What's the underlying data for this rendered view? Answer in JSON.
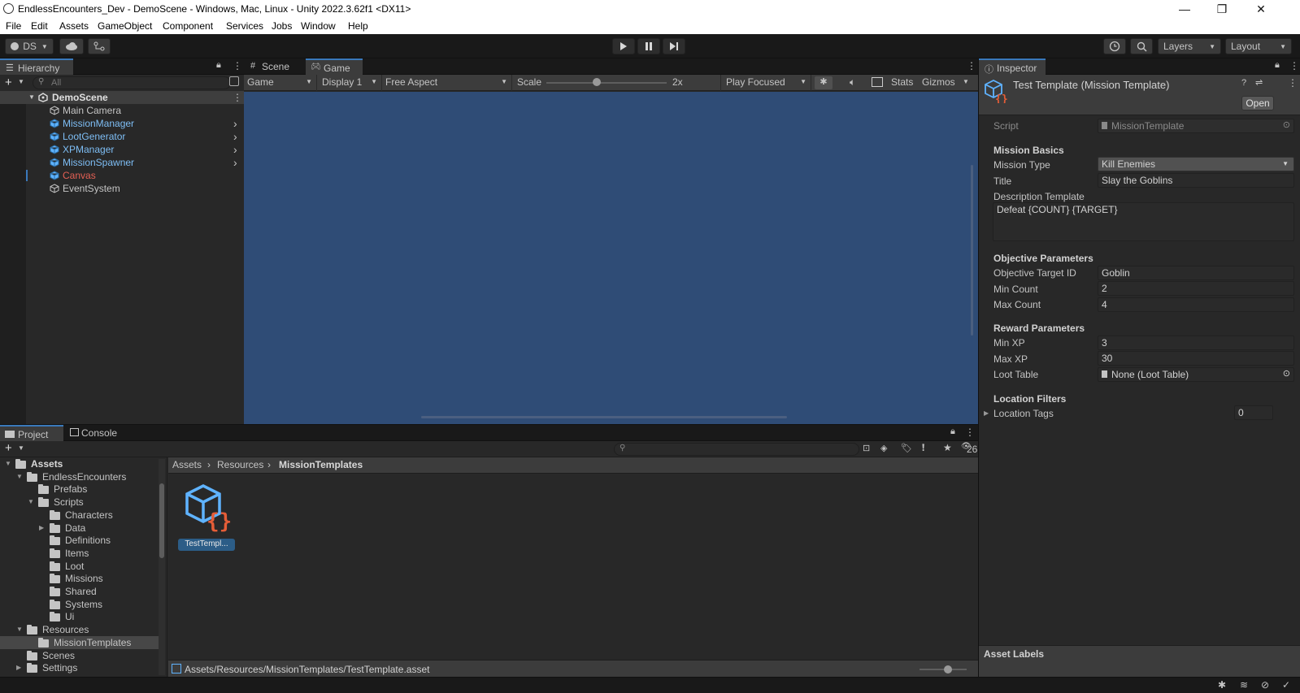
{
  "window": {
    "title": "EndlessEncounters_Dev - DemoScene - Windows, Mac, Linux - Unity 2022.3.62f1 <DX11>",
    "minimize": "—",
    "maximize": "❐",
    "close": "✕"
  },
  "menu": [
    "File",
    "Edit",
    "Assets",
    "GameObject",
    "Component",
    "Services",
    "Jobs",
    "Window",
    "Help"
  ],
  "toolbar": {
    "account_label": "DS",
    "layers_label": "Layers",
    "layout_label": "Layout"
  },
  "hierarchy": {
    "tab_label": "Hierarchy",
    "search_placeholder": "All",
    "scene_name": "DemoScene",
    "items": [
      {
        "label": "Main Camera",
        "style": "normal"
      },
      {
        "label": "MissionManager",
        "style": "prefab"
      },
      {
        "label": "LootGenerator",
        "style": "prefab"
      },
      {
        "label": "XPManager",
        "style": "prefab"
      },
      {
        "label": "MissionSpawner",
        "style": "prefab"
      },
      {
        "label": "Canvas",
        "style": "missing"
      },
      {
        "label": "EventSystem",
        "style": "normal"
      }
    ]
  },
  "game_view": {
    "tabs": [
      "Scene",
      "Game"
    ],
    "active_tab": "Game",
    "mode": "Game",
    "display": "Display 1",
    "aspect": "Free Aspect",
    "scale_label": "Scale",
    "scale_value": "2x",
    "scale_fraction": 0.42,
    "play_mode": "Play Focused",
    "stats": "Stats",
    "gizmos": "Gizmos",
    "background_color": "#2f4c76"
  },
  "inspector": {
    "tab_label": "Inspector",
    "object_title": "Test Template (Mission Template)",
    "open_button": "Open",
    "script_label": "Script",
    "script_value": "MissionTemplate",
    "sections": {
      "basics": "Mission Basics",
      "objective": "Objective Parameters",
      "reward": "Reward Parameters",
      "location": "Location Filters"
    },
    "mission_type_label": "Mission Type",
    "mission_type_value": "Kill Enemies",
    "title_label": "Title",
    "title_value": "Slay the Goblins",
    "description_label": "Description Template",
    "description_value": "Defeat {COUNT} {TARGET}",
    "objective_target_label": "Objective Target ID",
    "objective_target_value": "Goblin",
    "min_count_label": "Min Count",
    "min_count_value": "2",
    "max_count_label": "Max Count",
    "max_count_value": "4",
    "min_xp_label": "Min XP",
    "min_xp_value": "3",
    "max_xp_label": "Max XP",
    "max_xp_value": "30",
    "loot_table_label": "Loot Table",
    "loot_table_value": "None (Loot Table)",
    "location_tags_label": "Location Tags",
    "location_tags_value": "0",
    "asset_labels": "Asset Labels"
  },
  "project": {
    "tabs": [
      "Project",
      "Console"
    ],
    "hidden_count": "26",
    "breadcrumb": [
      "Assets",
      "Resources",
      "MissionTemplates"
    ],
    "tree": [
      {
        "label": "Assets",
        "depth": 0,
        "arrow": "down",
        "bold": true
      },
      {
        "label": "EndlessEncounters",
        "depth": 1,
        "arrow": "down"
      },
      {
        "label": "Prefabs",
        "depth": 2,
        "arrow": ""
      },
      {
        "label": "Scripts",
        "depth": 2,
        "arrow": "down"
      },
      {
        "label": "Characters",
        "depth": 3,
        "arrow": ""
      },
      {
        "label": "Data",
        "depth": 3,
        "arrow": "right"
      },
      {
        "label": "Definitions",
        "depth": 3,
        "arrow": ""
      },
      {
        "label": "Items",
        "depth": 3,
        "arrow": ""
      },
      {
        "label": "Loot",
        "depth": 3,
        "arrow": ""
      },
      {
        "label": "Missions",
        "depth": 3,
        "arrow": ""
      },
      {
        "label": "Shared",
        "depth": 3,
        "arrow": ""
      },
      {
        "label": "Systems",
        "depth": 3,
        "arrow": ""
      },
      {
        "label": "Ui",
        "depth": 3,
        "arrow": ""
      },
      {
        "label": "Resources",
        "depth": 1,
        "arrow": "down"
      },
      {
        "label": "MissionTemplates",
        "depth": 2,
        "arrow": "",
        "selected": true
      },
      {
        "label": "Scenes",
        "depth": 1,
        "arrow": ""
      },
      {
        "label": "Settings",
        "depth": 1,
        "arrow": "right"
      }
    ],
    "asset_name": "TestTempl...",
    "status_path": "Assets/Resources/MissionTemplates/TestTemplate.asset",
    "zoom_fraction": 0.6
  }
}
